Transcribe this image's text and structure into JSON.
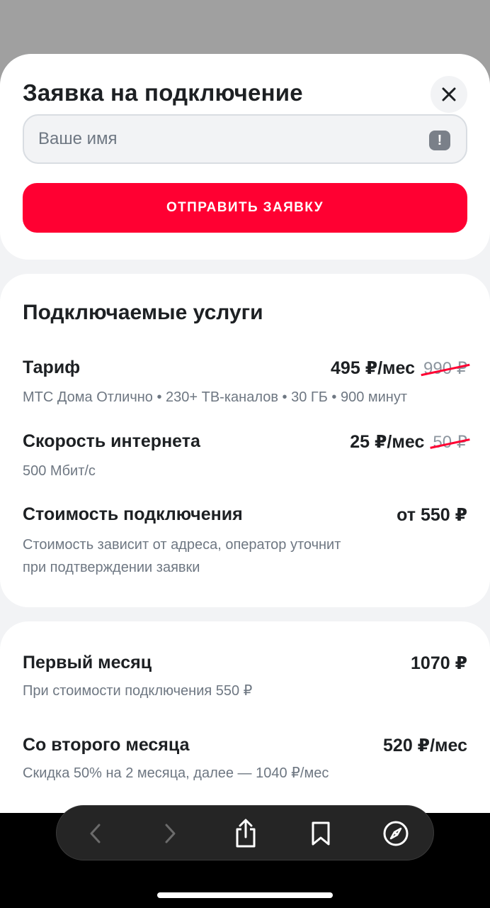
{
  "form": {
    "title": "Заявка на подключение",
    "name_placeholder": "Ваше имя",
    "name_value": "",
    "alert_glyph": "!",
    "submit_label": "ОТПРАВИТЬ ЗАЯВКУ"
  },
  "services": {
    "title": "Подключаемые услуги",
    "rows": [
      {
        "title": "Тариф",
        "price": "495 ₽/мес",
        "old_price": "990 ₽",
        "desc": "МТС Дома Отлично • 230+ ТВ-каналов • 30 ГБ • 900 минут"
      },
      {
        "title": "Скорость интернета",
        "price": "25 ₽/мес",
        "old_price": "50 ₽",
        "desc": "500 Мбит/с"
      },
      {
        "title": "Стоимость подключения",
        "price": "от 550 ₽",
        "desc_line1": "Стоимость зависит от адреса, оператор уточнит",
        "desc_line2": "при подтверждении заявки"
      }
    ]
  },
  "summary": {
    "rows": [
      {
        "title": "Первый месяц",
        "price": "1070 ₽",
        "desc": "При стоимости подключения 550 ₽"
      },
      {
        "title": "Со второго месяца",
        "price": "520 ₽/мес",
        "desc": "Скидка 50% на 2 месяца, далее — 1040 ₽/мес"
      }
    ]
  },
  "colors": {
    "accent": "#ff0032",
    "text_primary": "#1d2023",
    "text_secondary": "#6e7782",
    "background": "#f2f3f5"
  },
  "browser_toolbar": {
    "icons": [
      "back-icon",
      "forward-icon",
      "share-icon",
      "bookmarks-icon",
      "compass-icon"
    ]
  }
}
